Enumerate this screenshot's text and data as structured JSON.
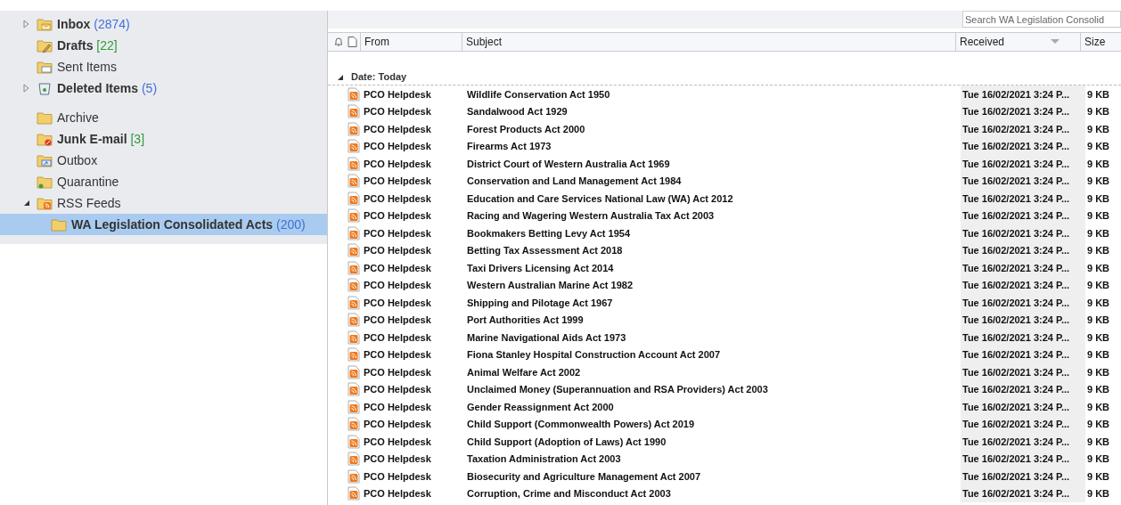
{
  "folder_sections": [
    {
      "folders": [
        {
          "name": "Inbox",
          "count": "(2874)",
          "color": "#3f6fd8",
          "kind": "inbox",
          "expanded": false,
          "bold": true,
          "selected": false
        },
        {
          "name": "Drafts",
          "count": "[22]",
          "color": "#2e9a3a",
          "kind": "drafts",
          "bold": true,
          "selected": false
        },
        {
          "name": "Sent Items",
          "kind": "sent",
          "bold": false,
          "selected": false
        },
        {
          "name": "Deleted Items",
          "count": "(5)",
          "color": "#3f6fd8",
          "kind": "deleted",
          "expanded": false,
          "bold": true,
          "selected": false
        }
      ]
    },
    {
      "folders": [
        {
          "name": "Archive",
          "kind": "folder",
          "bold": false,
          "selected": false
        },
        {
          "name": "Junk E-mail",
          "count": "[3]",
          "color": "#2e9a3a",
          "kind": "junk",
          "bold": true,
          "selected": false
        },
        {
          "name": "Outbox",
          "kind": "outbox",
          "bold": false,
          "selected": false
        },
        {
          "name": "Quarantine",
          "kind": "quarantine",
          "bold": false,
          "selected": false
        },
        {
          "name": "RSS Feeds",
          "kind": "rss",
          "expanded": true,
          "bold": false,
          "selected": false,
          "children": [
            {
              "name": "WA Legislation Consolidated Acts",
              "count": "(200)",
              "color": "#3f6fd8",
              "kind": "folder",
              "bold": true,
              "selected": true
            }
          ]
        }
      ]
    }
  ],
  "search": {
    "placeholder": "Search WA Legislation Consolid"
  },
  "table": {
    "columns": [
      "From",
      "Subject",
      "Received",
      "Size"
    ],
    "group": {
      "label": "Date: Today",
      "expanded": true
    },
    "rows": [
      {
        "from": "PCO Helpdesk",
        "subject": "Wildlife Conservation Act 1950",
        "received": "Tue 16/02/2021 3:24 P...",
        "size": "9 KB"
      },
      {
        "from": "PCO Helpdesk",
        "subject": "Sandalwood Act 1929",
        "received": "Tue 16/02/2021 3:24 P...",
        "size": "9 KB"
      },
      {
        "from": "PCO Helpdesk",
        "subject": "Forest Products Act 2000",
        "received": "Tue 16/02/2021 3:24 P...",
        "size": "9 KB"
      },
      {
        "from": "PCO Helpdesk",
        "subject": "Firearms Act 1973",
        "received": "Tue 16/02/2021 3:24 P...",
        "size": "9 KB"
      },
      {
        "from": "PCO Helpdesk",
        "subject": "District Court of Western Australia Act 1969",
        "received": "Tue 16/02/2021 3:24 P...",
        "size": "9 KB"
      },
      {
        "from": "PCO Helpdesk",
        "subject": "Conservation and Land Management Act 1984",
        "received": "Tue 16/02/2021 3:24 P...",
        "size": "9 KB"
      },
      {
        "from": "PCO Helpdesk",
        "subject": "Education and Care Services National Law (WA) Act 2012",
        "received": "Tue 16/02/2021 3:24 P...",
        "size": "9 KB"
      },
      {
        "from": "PCO Helpdesk",
        "subject": "Racing and Wagering Western Australia Tax Act 2003",
        "received": "Tue 16/02/2021 3:24 P...",
        "size": "9 KB"
      },
      {
        "from": "PCO Helpdesk",
        "subject": "Bookmakers Betting Levy Act 1954",
        "received": "Tue 16/02/2021 3:24 P...",
        "size": "9 KB"
      },
      {
        "from": "PCO Helpdesk",
        "subject": "Betting Tax Assessment Act 2018",
        "received": "Tue 16/02/2021 3:24 P...",
        "size": "9 KB"
      },
      {
        "from": "PCO Helpdesk",
        "subject": "Taxi Drivers Licensing Act 2014",
        "received": "Tue 16/02/2021 3:24 P...",
        "size": "9 KB"
      },
      {
        "from": "PCO Helpdesk",
        "subject": "Western Australian Marine Act 1982",
        "received": "Tue 16/02/2021 3:24 P...",
        "size": "9 KB"
      },
      {
        "from": "PCO Helpdesk",
        "subject": "Shipping and Pilotage Act 1967",
        "received": "Tue 16/02/2021 3:24 P...",
        "size": "9 KB"
      },
      {
        "from": "PCO Helpdesk",
        "subject": "Port Authorities Act 1999",
        "received": "Tue 16/02/2021 3:24 P...",
        "size": "9 KB"
      },
      {
        "from": "PCO Helpdesk",
        "subject": "Marine Navigational Aids Act 1973",
        "received": "Tue 16/02/2021 3:24 P...",
        "size": "9 KB"
      },
      {
        "from": "PCO Helpdesk",
        "subject": "Fiona Stanley Hospital Construction Account Act 2007",
        "received": "Tue 16/02/2021 3:24 P...",
        "size": "9 KB"
      },
      {
        "from": "PCO Helpdesk",
        "subject": "Animal Welfare Act 2002",
        "received": "Tue 16/02/2021 3:24 P...",
        "size": "9 KB"
      },
      {
        "from": "PCO Helpdesk",
        "subject": "Unclaimed Money (Superannuation and RSA Providers) Act 2003",
        "received": "Tue 16/02/2021 3:24 P...",
        "size": "9 KB"
      },
      {
        "from": "PCO Helpdesk",
        "subject": "Gender Reassignment Act 2000",
        "received": "Tue 16/02/2021 3:24 P...",
        "size": "9 KB"
      },
      {
        "from": "PCO Helpdesk",
        "subject": "Child Support (Commonwealth Powers) Act 2019",
        "received": "Tue 16/02/2021 3:24 P...",
        "size": "9 KB"
      },
      {
        "from": "PCO Helpdesk",
        "subject": "Child Support (Adoption of Laws) Act 1990",
        "received": "Tue 16/02/2021 3:24 P...",
        "size": "9 KB"
      },
      {
        "from": "PCO Helpdesk",
        "subject": "Taxation Administration Act 2003",
        "received": "Tue 16/02/2021 3:24 P...",
        "size": "9 KB"
      },
      {
        "from": "PCO Helpdesk",
        "subject": "Biosecurity and Agriculture Management Act 2007",
        "received": "Tue 16/02/2021 3:24 P...",
        "size": "9 KB"
      },
      {
        "from": "PCO Helpdesk",
        "subject": "Corruption, Crime and Misconduct Act 2003",
        "received": "Tue 16/02/2021 3:24 P...",
        "size": "9 KB"
      }
    ]
  }
}
